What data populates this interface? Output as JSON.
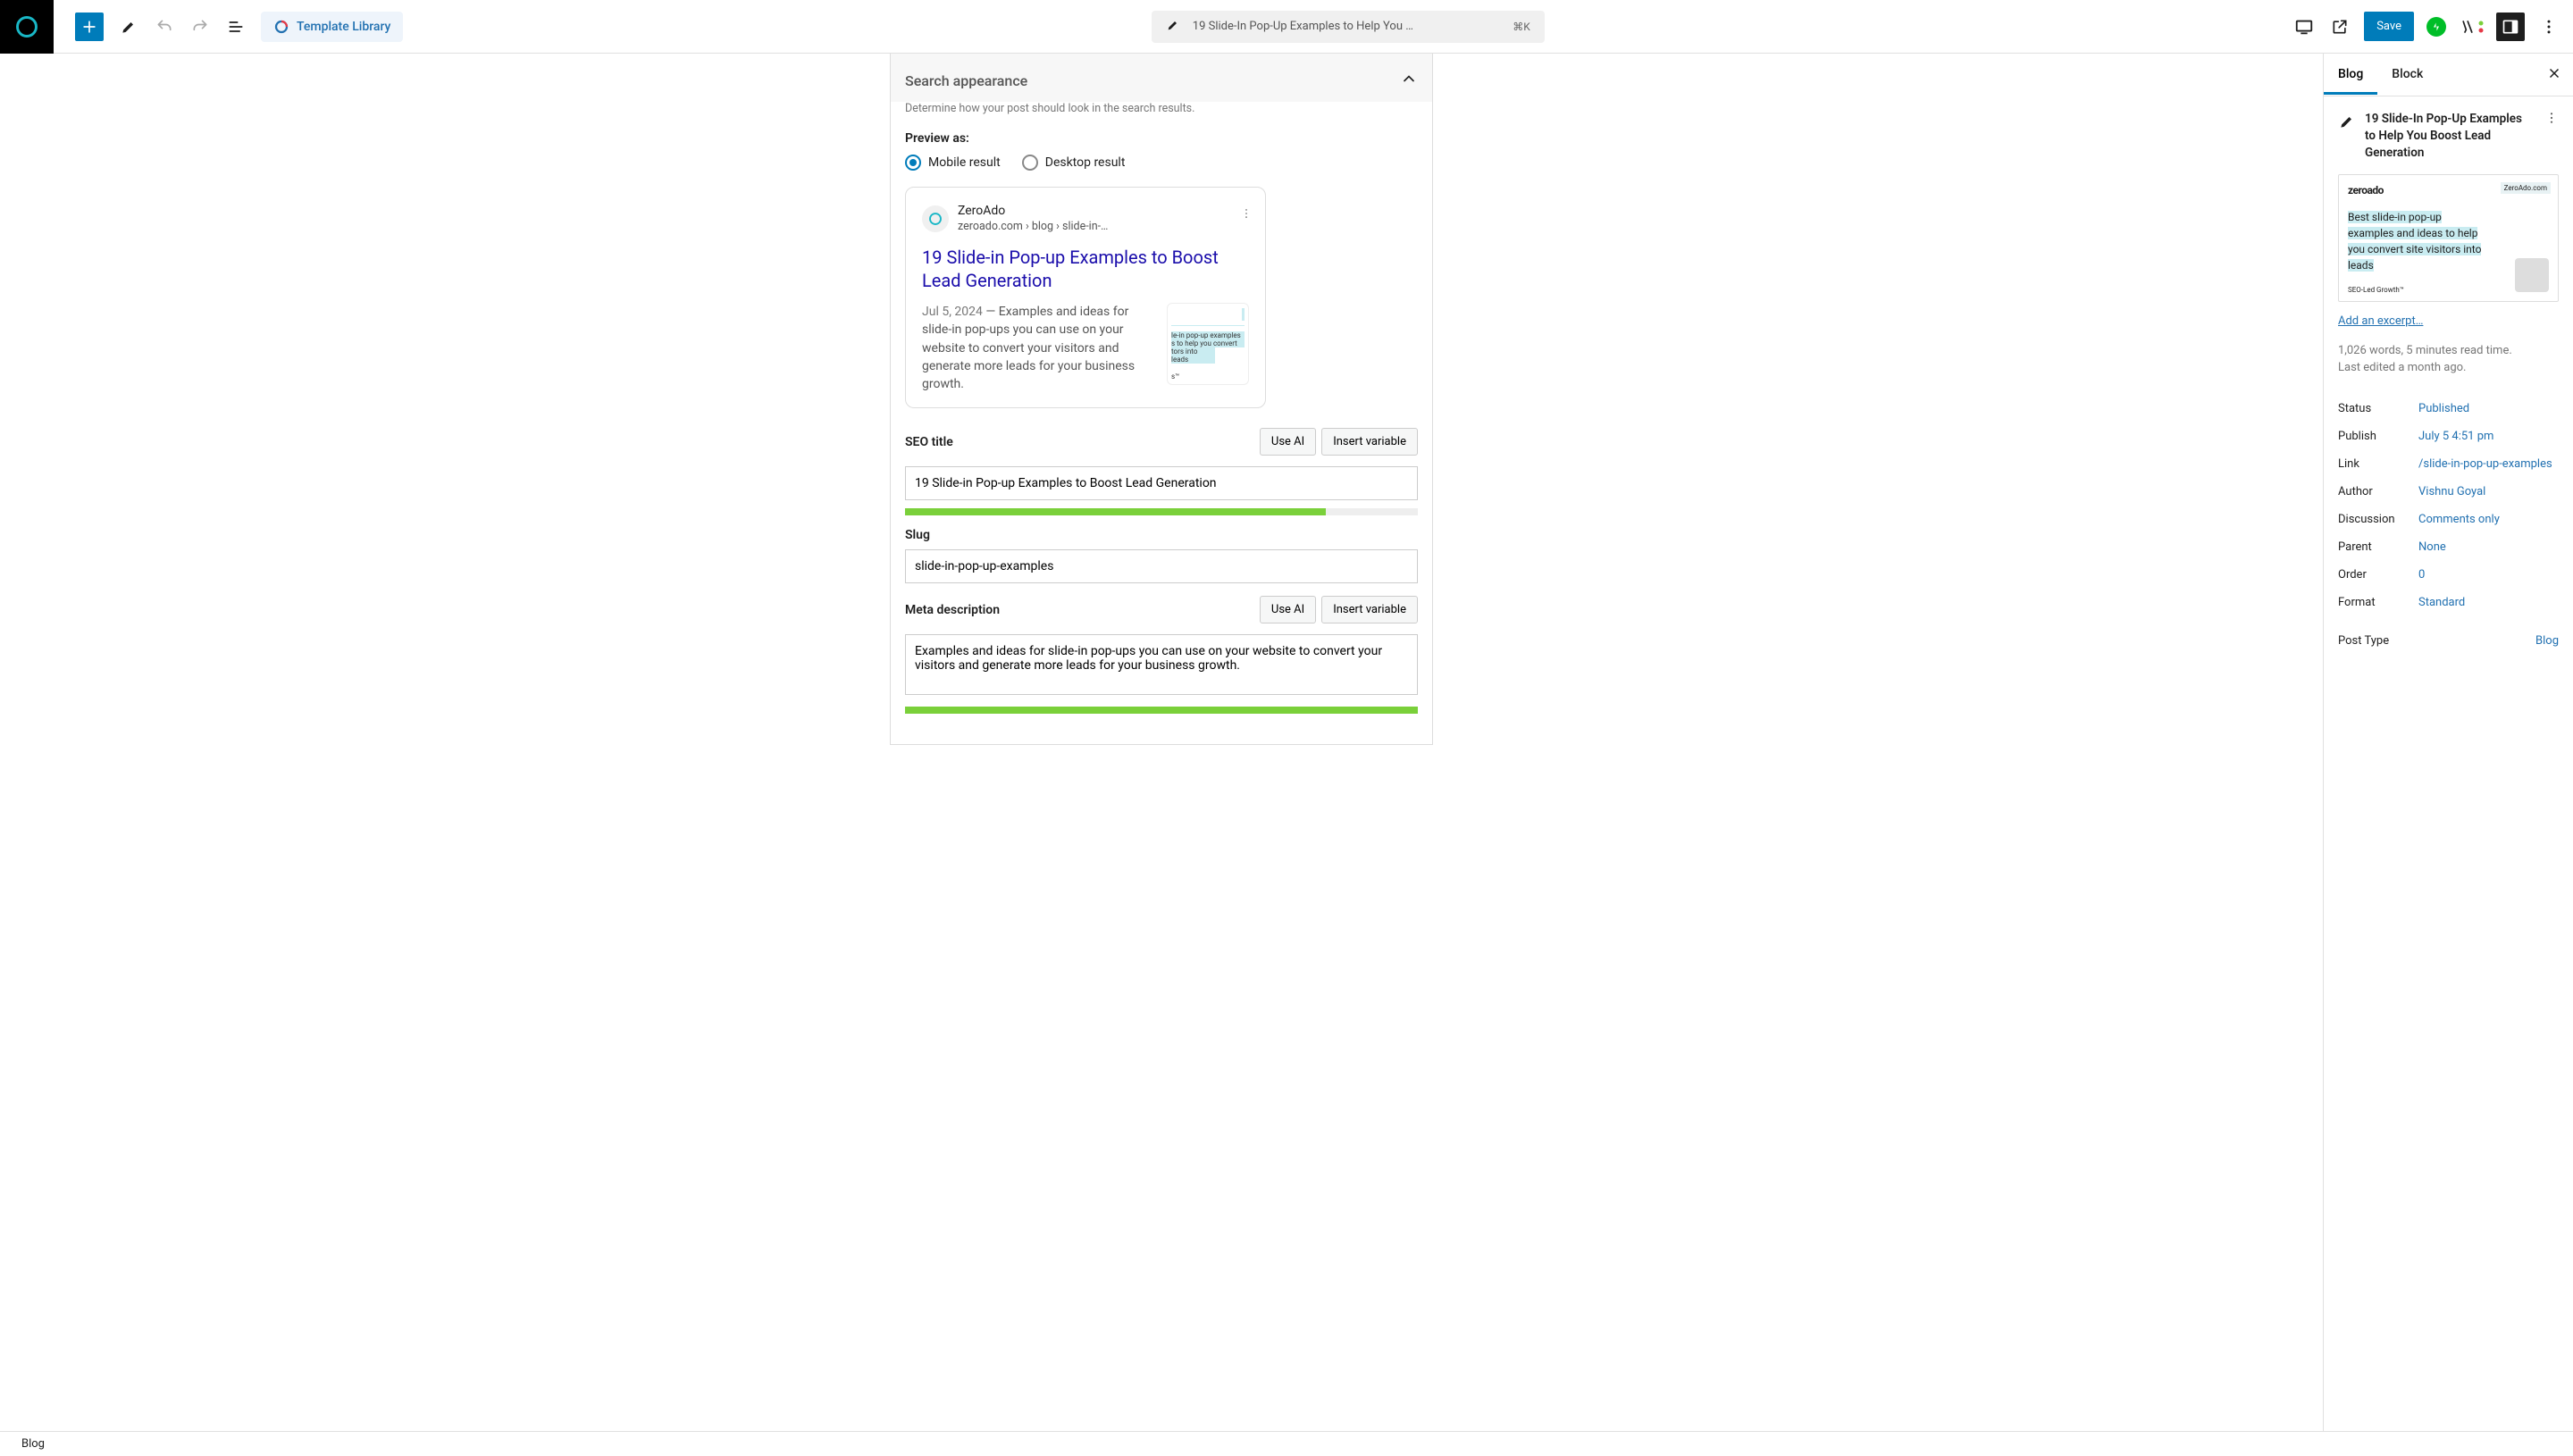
{
  "topbar": {
    "template_library": "Template Library",
    "doc_title": "19 Slide-In Pop-Up Examples to Help You …",
    "shortcut": "⌘K",
    "save": "Save"
  },
  "panel": {
    "title": "Search appearance",
    "desc": "Determine how your post should look in the search results.",
    "preview_as": "Preview as:",
    "mobile": "Mobile result",
    "desktop": "Desktop result"
  },
  "serp": {
    "site": "ZeroAdo",
    "url": "zeroado.com › blog › slide-in-…",
    "title": "19 Slide-in Pop-up Examples to Boost Lead Generation",
    "date": "Jul 5, 2024",
    "desc": "Examples and ideas for slide-in pop-ups you can use on your website to convert your visitors and generate more leads for your business growth.",
    "thumb1": "le-in pop-up examples",
    "thumb2": "s to help you convert",
    "thumb3": "tors into leads",
    "thumb4": "s™"
  },
  "seo": {
    "title_label": "SEO title",
    "use_ai": "Use AI",
    "insert_var": "Insert variable",
    "title_value": "19 Slide-in Pop-up Examples to Boost Lead Generation",
    "slug_label": "Slug",
    "slug_value": "slide-in-pop-up-examples",
    "meta_label": "Meta description",
    "meta_value": "Examples and ideas for slide-in pop-ups you can use on your website to convert your visitors and generate more leads for your business growth."
  },
  "sidebar": {
    "tab_blog": "Blog",
    "tab_block": "Block",
    "post_title": "19 Slide-In Pop-Up Examples to Help You Boost Lead Generation",
    "feat": {
      "brand": "zeroado",
      "url": "ZeroAdo.com",
      "caption": "Best slide-in pop-up examples and ideas to help you convert site visitors into leads",
      "tag": "SEO-Led Growth™"
    },
    "excerpt_link": "Add an excerpt…",
    "stats": "1,026 words, 5 minutes read time.",
    "edited": "Last edited a month ago.",
    "props": {
      "status_l": "Status",
      "status_v": "Published",
      "publish_l": "Publish",
      "publish_v": "July 5 4:51 pm",
      "link_l": "Link",
      "link_v": "/slide-in-pop-up-examples",
      "author_l": "Author",
      "author_v": "Vishnu Goyal",
      "discussion_l": "Discussion",
      "discussion_v": "Comments only",
      "parent_l": "Parent",
      "parent_v": "None",
      "order_l": "Order",
      "order_v": "0",
      "format_l": "Format",
      "format_v": "Standard",
      "posttype_l": "Post Type",
      "posttype_v": "Blog"
    }
  },
  "footer": {
    "breadcrumb": "Blog"
  }
}
